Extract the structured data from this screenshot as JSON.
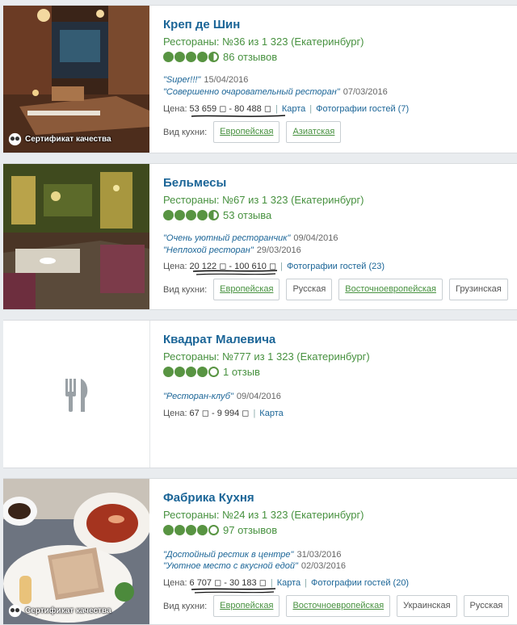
{
  "cards": [
    {
      "title": "Креп де Шин",
      "rank": "Рестораны: №36 из 1 323 (Екатеринбург)",
      "rating": 4.5,
      "reviews": "86 отзывов",
      "quotes": [
        {
          "text": "\"Super!!!\"",
          "date": "15/04/2016"
        },
        {
          "text": "\"Совершенно очаровательный ресторан\"",
          "date": "07/03/2016"
        }
      ],
      "price_label": "Цена:",
      "price": "53 659 ◻ - 80 488 ◻",
      "map": "Карта",
      "photos": "Фотографии гостей (7)",
      "cuisine_label": "Вид кухни:",
      "cuisines": [
        "Европейская",
        "Азиатская"
      ],
      "certificate": "Сертификат качества"
    },
    {
      "title": "Бельмесы",
      "rank": "Рестораны: №67 из 1 323 (Екатеринбург)",
      "rating": 4.5,
      "reviews": "53 отзыва",
      "quotes": [
        {
          "text": "\"Очень уютный ресторанчик\"",
          "date": "09/04/2016"
        },
        {
          "text": "\"Неплохой ресторан\"",
          "date": "29/03/2016"
        }
      ],
      "price_label": "Цена:",
      "price": "20 122 ◻ - 100 610 ◻",
      "photos": "Фотографии гостей (23)",
      "cuisine_label": "Вид кухни:",
      "cuisines": [
        "Европейская",
        "Русская",
        "Восточноевропейская",
        "Грузинская"
      ]
    },
    {
      "title": "Квадрат Малевича",
      "rank": "Рестораны: №777 из 1 323 (Екатеринбург)",
      "rating": 4.0,
      "reviews": "1 отзыв",
      "quotes": [
        {
          "text": "\"Ресторан-клуб\"",
          "date": "09/04/2016"
        }
      ],
      "price_label": "Цена:",
      "price": "67 ◻ - 9 994 ◻",
      "map": "Карта"
    },
    {
      "title": "Фабрика Кухня",
      "rank": "Рестораны: №24 из 1 323 (Екатеринбург)",
      "rating": 4.0,
      "reviews": "97 отзывов",
      "quotes": [
        {
          "text": "\"Достойный рестик в центре\"",
          "date": "31/03/2016"
        },
        {
          "text": "\"Уютное место с вкусной едой\"",
          "date": "02/03/2016"
        }
      ],
      "price_label": "Цена:",
      "price": "6 707 ◻ - 30 183 ◻",
      "map": "Карта",
      "photos": "Фотографии гостей (20)",
      "cuisine_label": "Вид кухни:",
      "cuisines": [
        "Европейская",
        "Восточноевропейская",
        "Украинская",
        "Русская"
      ],
      "certificate": "Сертификат качества"
    }
  ],
  "colors": {
    "brand_green": "#589442",
    "link_blue": "#1b6597"
  },
  "icons": {
    "placeholder": "fork-knife-icon",
    "certificate": "owl-icon"
  }
}
